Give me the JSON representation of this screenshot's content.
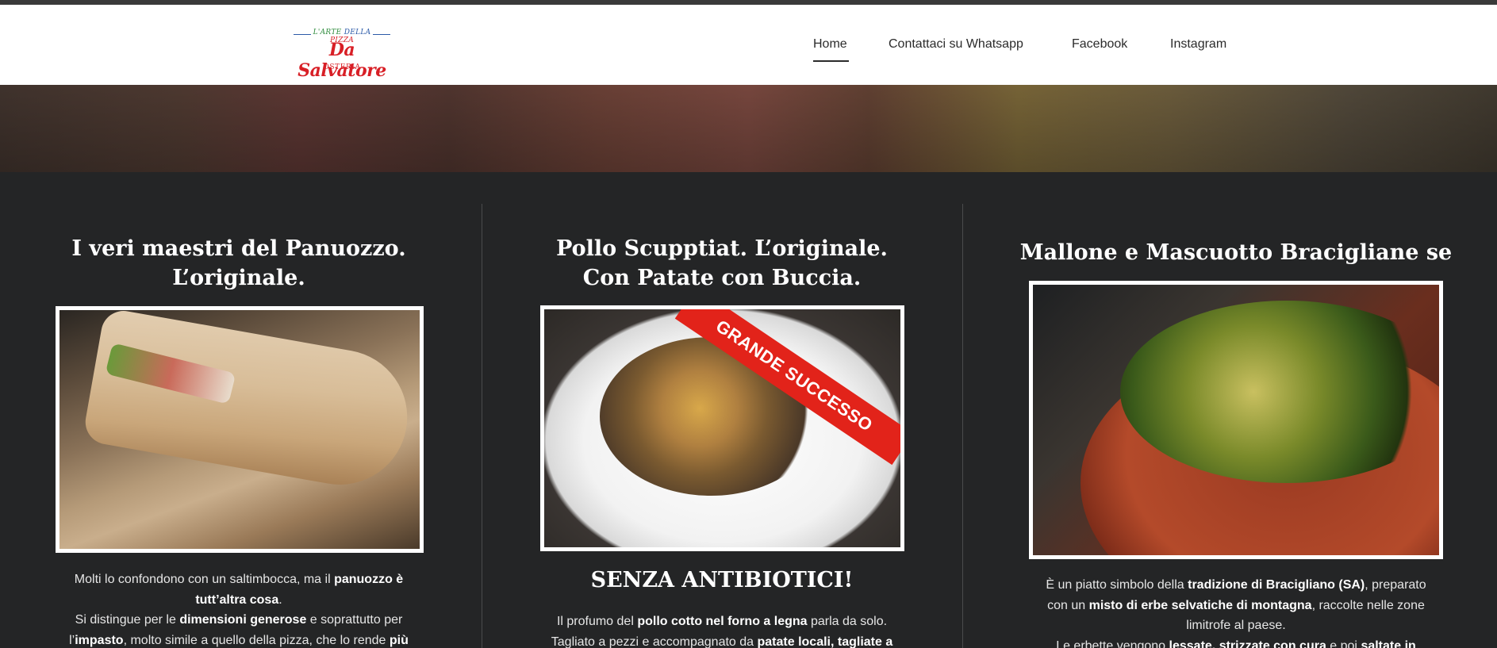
{
  "logo": {
    "tagline_part1": "L'ARTE",
    "tagline_part2": "DELLA",
    "tagline_part3": "PIZZA",
    "name": "Da Salvatore",
    "subtitle": "OSTERIA"
  },
  "nav": {
    "items": [
      {
        "label": "Home",
        "active": true
      },
      {
        "label": "Contattaci su Whatsapp",
        "active": false
      },
      {
        "label": "Facebook",
        "active": false
      },
      {
        "label": "Instagram",
        "active": false
      }
    ]
  },
  "columns": [
    {
      "title_line1": "I veri maestri del Panuozzo.",
      "title_line2": "L’originale.",
      "paragraph": [
        {
          "t": "Molti lo confondono con un saltimbocca, ma il "
        },
        {
          "b": "panuozzo è"
        },
        {
          "t": " "
        },
        {
          "b": "tutt’altra cosa"
        },
        {
          "t": "."
        },
        {
          "t": "Si distingue per le "
        },
        {
          "b": "dimensioni generose"
        },
        {
          "t": " e soprattutto per"
        },
        {
          "t": "l’"
        },
        {
          "b": "impasto"
        },
        {
          "t": ", molto simile a quello della pizza, che lo rende "
        },
        {
          "b": "più"
        }
      ]
    },
    {
      "title_line1": "Pollo Scupptiat. L’originale.",
      "title_line2": "Con Patate con Buccia.",
      "badge": "GRANDE SUCCESSO",
      "subheading": "SENZA ANTIBIOTICI!",
      "paragraph": [
        {
          "t": "Il profumo del "
        },
        {
          "b": "pollo cotto nel forno a legna"
        },
        {
          "t": " parla da solo."
        },
        {
          "t": "Tagliato a pezzi e accompagnato da "
        },
        {
          "b": "patate locali, tagliate a"
        }
      ]
    },
    {
      "title_line1": "Mallone e Mascuotto Bracigliane se",
      "paragraph": [
        {
          "t": "È un piatto simbolo della "
        },
        {
          "b": "tradizione di Bracigliano (SA)"
        },
        {
          "t": ", preparato"
        },
        {
          "t": "con un "
        },
        {
          "b": "misto di erbe selvatiche di montagna"
        },
        {
          "t": ", raccolte nelle zone"
        },
        {
          "t": "limitrofe al paese."
        },
        {
          "t": "Le erbette vengono "
        },
        {
          "b": "lessate, strizzate con cura"
        },
        {
          "t": " e poi "
        },
        {
          "b": "saltate in"
        }
      ]
    }
  ],
  "colors": {
    "accent_red": "#d81f26",
    "page_bg": "#242526",
    "header_bg": "#ffffff"
  }
}
